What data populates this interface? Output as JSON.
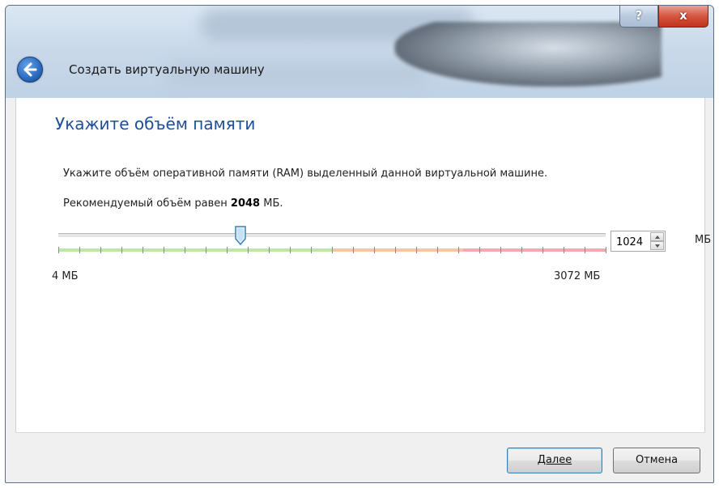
{
  "window": {
    "title": "Создать виртуальную машину",
    "help_label": "?",
    "close_label": "x"
  },
  "page": {
    "heading": "Укажите объём памяти",
    "description": "Укажите объём оперативной памяти (RAM) выделенный данной виртуальной машине.",
    "recommend_prefix": "Рекомендуемый объём равен",
    "recommend_value": "2048",
    "recommend_unit": "МБ."
  },
  "memory": {
    "slider_min_label": "4 МБ",
    "slider_max_label": "3072 МБ",
    "min": 4,
    "max": 3072,
    "value": 1024,
    "value_text": "1024",
    "unit": "МБ"
  },
  "footer": {
    "next_label": "Далее",
    "cancel_label": "Отмена"
  },
  "colors": {
    "heading": "#1f4e99",
    "zone_safe": "#bfe6a9",
    "zone_warn": "#f4c6a6",
    "zone_danger": "#f2a9b3"
  }
}
